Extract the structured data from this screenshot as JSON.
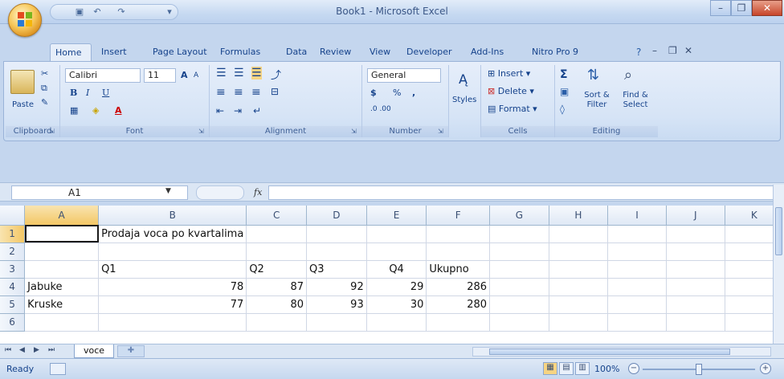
{
  "window": {
    "title": "Book1 - Microsoft Excel",
    "minimize_label": "–",
    "restore_label": "❐",
    "close_label": "✕"
  },
  "qat": {
    "save_icon": "save-icon",
    "undo_icon": "undo-icon",
    "redo_icon": "redo-icon"
  },
  "ribbon_tabs": [
    "Home",
    "Insert",
    "Page Layout",
    "Formulas",
    "Data",
    "Review",
    "View",
    "Developer",
    "Add-Ins",
    "Nitro Pro 9"
  ],
  "ribbon": {
    "clipboard": {
      "paste_label": "Paste",
      "group_label": "Clipboard"
    },
    "font": {
      "font_name": "Calibri",
      "font_size": "11",
      "bold": "B",
      "italic": "I",
      "underline": "U",
      "grow": "A",
      "shrink": "A",
      "fill_letter": "A",
      "group_label": "Font"
    },
    "alignment": {
      "group_label": "Alignment"
    },
    "number": {
      "format": "General",
      "currency": "$",
      "percent": "%",
      "comma": ",",
      "inc_decimal": ".0 .00",
      "group_label": "Number"
    },
    "styles": {
      "label": "Styles"
    },
    "cells": {
      "insert": "Insert",
      "delete": "Delete",
      "format": "Format",
      "group_label": "Cells"
    },
    "editing": {
      "sigma": "Σ",
      "sort_filter": "Sort & Filter",
      "find_select": "Find & Select",
      "group_label": "Editing"
    }
  },
  "formula_bar": {
    "cell_ref": "A1",
    "fx": "fx",
    "content": ""
  },
  "columns": [
    "A",
    "B",
    "C",
    "D",
    "E",
    "F",
    "G",
    "H",
    "I",
    "J",
    "K"
  ],
  "rows": [
    {
      "num": "1",
      "cells": [
        "",
        "Prodaja voca po kvartalima",
        "",
        "",
        "",
        "",
        "",
        "",
        "",
        "",
        ""
      ]
    },
    {
      "num": "2",
      "cells": [
        "",
        "",
        "",
        "",
        "",
        "",
        "",
        "",
        "",
        "",
        ""
      ]
    },
    {
      "num": "3",
      "cells": [
        "",
        "Q1",
        "Q2",
        "Q3",
        "Q4",
        "Ukupno",
        "",
        "",
        "",
        "",
        ""
      ]
    },
    {
      "num": "4",
      "cells": [
        "Jabuke",
        "78",
        "87",
        "92",
        "29",
        "286",
        "",
        "",
        "",
        "",
        ""
      ]
    },
    {
      "num": "5",
      "cells": [
        "Kruske",
        "77",
        "80",
        "93",
        "30",
        "280",
        "",
        "",
        "",
        "",
        ""
      ]
    },
    {
      "num": "6",
      "cells": [
        "",
        "",
        "",
        "",
        "",
        "",
        "",
        "",
        "",
        "",
        ""
      ]
    }
  ],
  "sheet_tab": "voce",
  "status": {
    "ready": "Ready",
    "zoom": "100%",
    "zoom_out": "−",
    "zoom_in": "+"
  }
}
